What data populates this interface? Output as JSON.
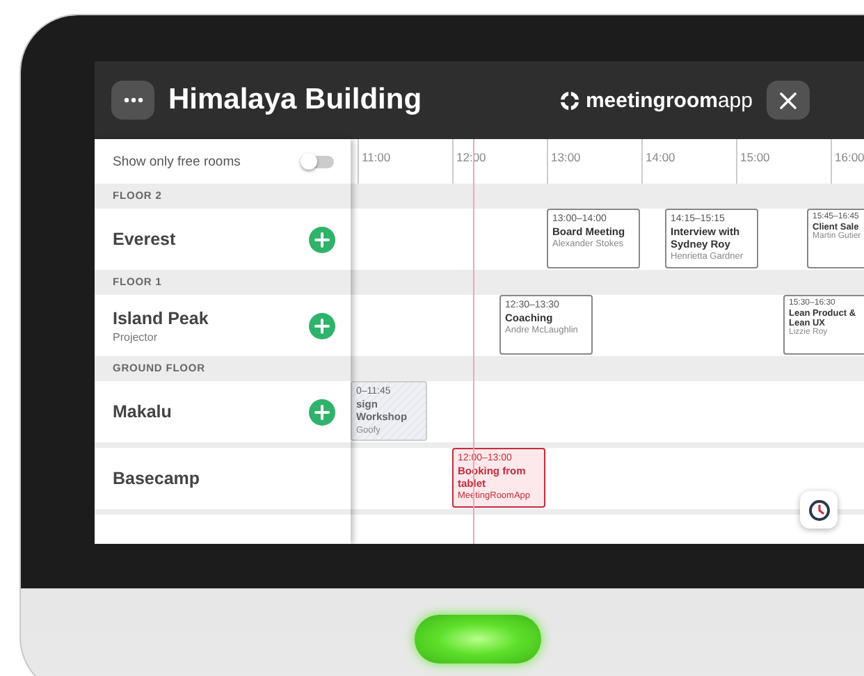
{
  "header": {
    "title": "Himalaya Building",
    "logo": "**meetingroom**app"
  },
  "sidebar": {
    "filter_label": "Show only free rooms",
    "filter_on": false
  },
  "timeline": {
    "hours": [
      "11:00",
      "12:00",
      "13:00",
      "14:00",
      "15:00",
      "16:00"
    ]
  },
  "sections": [
    {
      "heading": "FLOOR 2",
      "rooms": [
        {
          "name": "Everest",
          "bookable": true,
          "events": [
            {
              "kind": "normal",
              "time": "13:00–14:00",
              "title": "Board Meeting",
              "organizer": "Alexander Stokes"
            },
            {
              "kind": "normal",
              "time": "14:15–15:15",
              "title": "Interview with Sydney Roy",
              "organizer": "Henrietta Gardner"
            },
            {
              "kind": "normal",
              "time": "15:45–16:45",
              "title": "Client Sale",
              "organizer": "Martin Gutier"
            }
          ]
        }
      ]
    },
    {
      "heading": "FLOOR 1",
      "rooms": [
        {
          "name": "Island Peak",
          "subtitle": "Projector",
          "bookable": true,
          "events": [
            {
              "kind": "normal",
              "time": "12:30–13:30",
              "title": "Coaching",
              "organizer": "Andre McLaughlin"
            },
            {
              "kind": "normal",
              "time": "15:30–16:30",
              "title": "Lean Product & Lean UX",
              "organizer": "Lizzie Roy"
            }
          ]
        }
      ]
    },
    {
      "heading": "GROUND FLOOR",
      "rooms": [
        {
          "name": "Makalu",
          "bookable": true,
          "events": [
            {
              "kind": "past",
              "time": "0–11:45",
              "title": "sign Workshop",
              "organizer": "Goofy"
            }
          ]
        }
      ]
    },
    {
      "rooms": [
        {
          "name": "Basecamp",
          "bookable": false,
          "events": [
            {
              "kind": "own",
              "time": "12:00–13:00",
              "title": "Booking from tablet",
              "organizer": "MeetingRoomApp"
            }
          ]
        }
      ]
    }
  ]
}
